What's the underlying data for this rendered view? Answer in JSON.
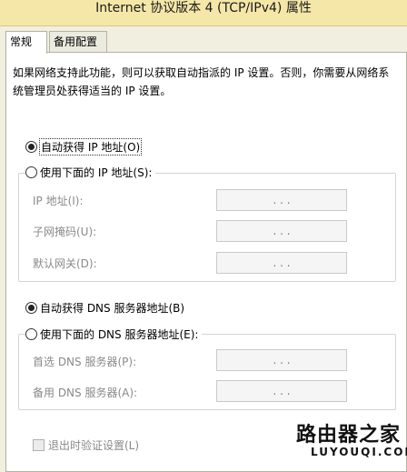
{
  "window": {
    "title": "Internet 协议版本 4 (TCP/IPv4) 属性"
  },
  "tabs": [
    {
      "label": "常规",
      "active": true
    },
    {
      "label": "备用配置",
      "active": false
    }
  ],
  "general": {
    "description": "如果网络支持此功能，则可以获取自动指派的 IP 设置。否则，你需要从网络系统管理员处获得适当的 IP 设置。",
    "ip_auto": {
      "label": "自动获得 IP 地址(O)",
      "checked": true
    },
    "ip_manual": {
      "label": "使用下面的 IP 地址(S):",
      "checked": false
    },
    "ip_fields": [
      {
        "label": "IP 地址(I):",
        "dots": ". . ."
      },
      {
        "label": "子网掩码(U):",
        "dots": ". . ."
      },
      {
        "label": "默认网关(D):",
        "dots": ". . ."
      }
    ],
    "dns_auto": {
      "label": "自动获得 DNS 服务器地址(B)",
      "checked": true
    },
    "dns_manual": {
      "label": "使用下面的 DNS 服务器地址(E):",
      "checked": false
    },
    "dns_fields": [
      {
        "label": "首选 DNS 服务器(P):",
        "dots": ". . ."
      },
      {
        "label": "备用 DNS 服务器(A):",
        "dots": ". . ."
      }
    ],
    "validate": {
      "label": "退出时验证设置(L)",
      "checked": false,
      "disabled": true
    }
  },
  "watermark": {
    "text": "路由器之家",
    "subtext": "LUYOUQI.COM"
  }
}
